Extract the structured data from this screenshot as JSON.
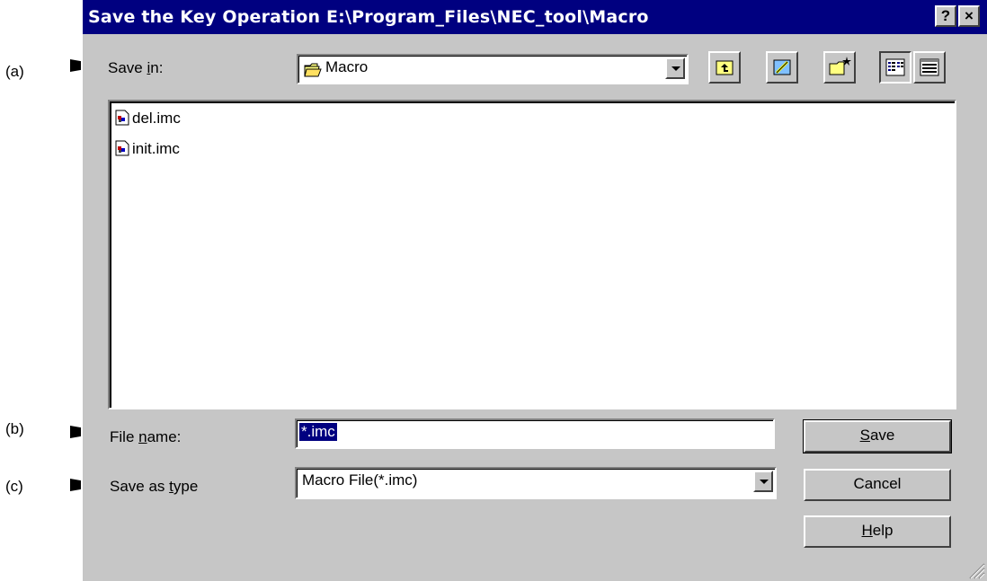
{
  "callouts": {
    "a": "(a)",
    "b": "(b)",
    "c": "(c)"
  },
  "window": {
    "title": "Save the Key Operation E:\\Program_Files\\NEC_tool\\Macro",
    "help_button": "?",
    "close_button": "×"
  },
  "save_in": {
    "label_pre": "Save ",
    "label_u": "i",
    "label_post": "n:",
    "value": "Macro"
  },
  "toolbar": {
    "buttons": [
      "up-one-level",
      "desktop",
      "create-new-folder",
      "list-view",
      "details-view"
    ]
  },
  "files": [
    {
      "name": "del.imc"
    },
    {
      "name": "init.imc"
    }
  ],
  "file_name": {
    "label_pre": "File ",
    "label_u": "n",
    "label_post": "ame:",
    "value": "*.imc"
  },
  "save_as_type": {
    "label_pre": "Save as ",
    "label_u": "t",
    "label_post": "ype",
    "value": "Macro File(*.imc)"
  },
  "buttons": {
    "save_u": "S",
    "save_rest": "ave",
    "cancel": "Cancel",
    "help_u": "H",
    "help_rest": "elp"
  },
  "colors": {
    "titlebar": "#000080",
    "dialog_face": "#c6c6c6",
    "selection": "#000080"
  }
}
